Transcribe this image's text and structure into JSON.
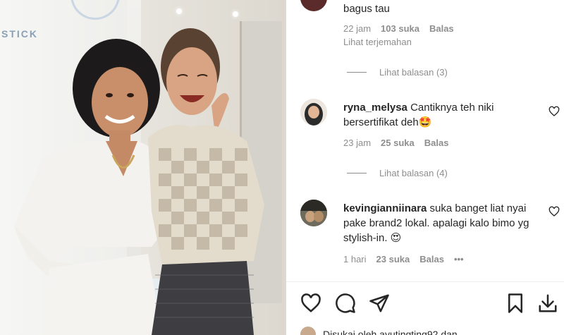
{
  "photo": {
    "wall_text": "STICK"
  },
  "comments": [
    {
      "text": "bagus tau",
      "time": "22 jam",
      "likes": "103 suka",
      "reply": "Balas",
      "translate": "Lihat terjemahan",
      "view_replies": "Lihat balasan (3)"
    },
    {
      "username": "ryna_melysa",
      "text": "Cantiknya teh niki bersertifikat deh🤩",
      "time": "23 jam",
      "likes": "25 suka",
      "reply": "Balas",
      "view_replies": "Lihat balasan (4)"
    },
    {
      "username": "kevingianniinara",
      "text": "suka banget liat nyai pake brand2 lokal. apalagi kalo bimo yg stylish-in. 😍",
      "time": "1 hari",
      "likes": "23 suka",
      "reply": "Balas",
      "more": "•••"
    }
  ],
  "footer": {
    "liked_by": "Disukai oleh ayutingting92 dan"
  },
  "icons": {
    "like": "heart-icon",
    "comment": "comment-icon",
    "share": "share-icon",
    "save": "bookmark-icon",
    "download": "download-icon"
  }
}
